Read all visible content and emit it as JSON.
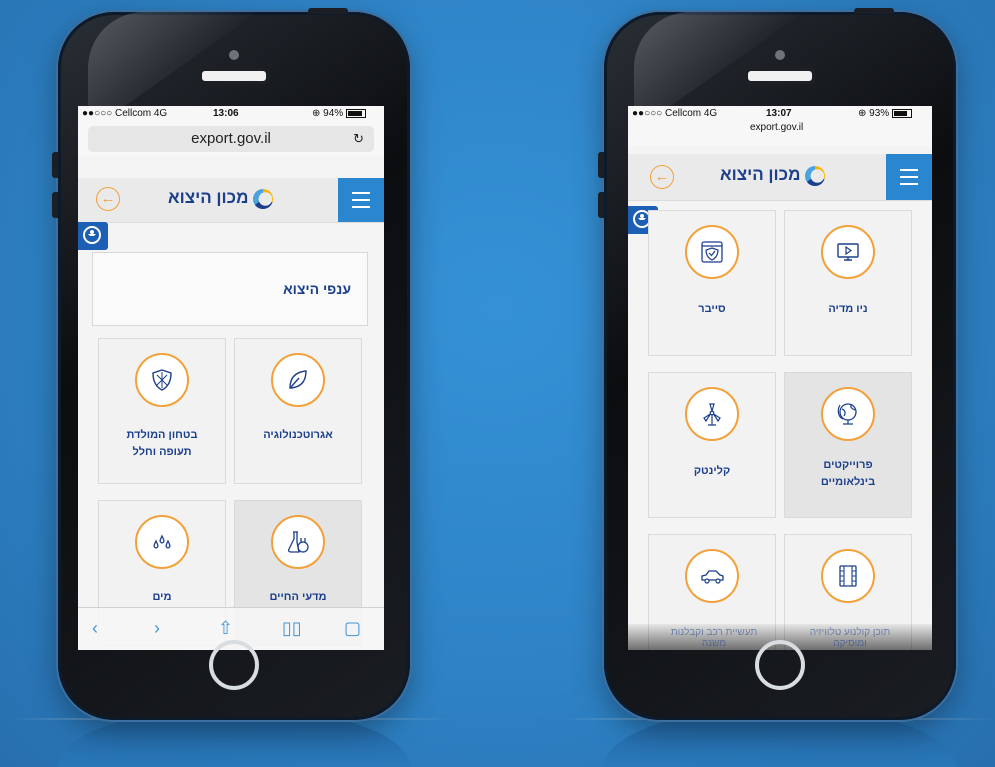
{
  "colors": {
    "background": "#2f86c9",
    "accent_orange": "#f2a13a",
    "brand_blue": "#1b3f8c",
    "menu_blue": "#2a86cf"
  },
  "left_phone": {
    "status": {
      "carrier": "●●○○○ Cellcom  4G",
      "time": "13:06",
      "battery": "94%"
    },
    "url": "export.gov.il",
    "reload_icon": "reload-icon",
    "logo_text": "מכון היצוא",
    "page_title": "ענפי היצוא",
    "tiles": [
      {
        "label": "אגרוטכנולוגיה",
        "icon": "leaf-icon"
      },
      {
        "label": "בטחון המולדת תעופה וחלל",
        "icon": "shield-icon"
      },
      {
        "label": "מדעי החיים",
        "icon": "flasks-icon"
      },
      {
        "label": "מים",
        "icon": "water-drops-icon"
      }
    ],
    "toolbar": [
      "back-icon",
      "forward-icon",
      "share-icon",
      "bookmarks-icon",
      "tabs-icon"
    ]
  },
  "right_phone": {
    "status": {
      "carrier": "●●○○○ Cellcom  4G",
      "time": "13:07",
      "battery": "93%",
      "url": "export.gov.il"
    },
    "logo_text": "מכון היצוא",
    "tiles": [
      {
        "label": "ניו מדיה",
        "icon": "monitor-play-icon"
      },
      {
        "label": "סייבר",
        "icon": "cyber-shield-icon"
      },
      {
        "label": "פרוייקטים בינלאומיים",
        "icon": "globe-icon"
      },
      {
        "label": "קלינטק",
        "icon": "wind-turbine-icon"
      },
      {
        "label": "תוכן קולנוע טלוויזיה ומוסיקה",
        "icon": "film-icon"
      },
      {
        "label": "תעשיית רכב וקבלנות משנה",
        "icon": "car-icon"
      }
    ]
  }
}
